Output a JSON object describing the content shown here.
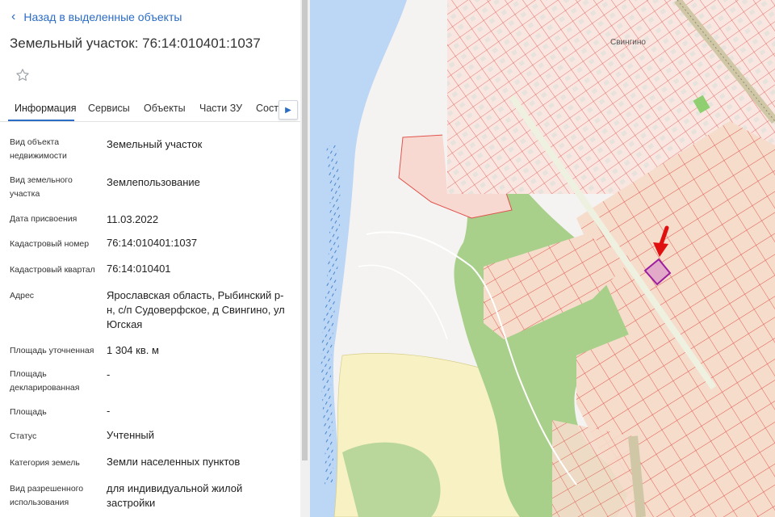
{
  "panel": {
    "back_label": "Назад в выделенные объекты",
    "title": "Земельный участок: 76:14:010401:1037",
    "tabs": [
      {
        "label": "Информация",
        "active": true
      },
      {
        "label": "Сервисы",
        "active": false
      },
      {
        "label": "Объекты",
        "active": false
      },
      {
        "label": "Части ЗУ",
        "active": false
      },
      {
        "label": "Соста",
        "active": false
      }
    ],
    "properties": [
      {
        "label": "Вид объекта недвижимости",
        "value": "Земельный участок"
      },
      {
        "label": "Вид земельного участка",
        "value": "Землепользование"
      },
      {
        "label": "Дата присвоения",
        "value": "11.03.2022"
      },
      {
        "label": "Кадастровый номер",
        "value": "76:14:010401:1037"
      },
      {
        "label": "Кадастровый квартал",
        "value": "76:14:010401"
      },
      {
        "label": "Адрес",
        "value": "Ярославская область, Рыбинский р-н, с/п Судоверфское, д Свингино, ул Югская"
      },
      {
        "label": "Площадь уточненная",
        "value": "1 304 кв. м"
      },
      {
        "label": "Площадь декларированная",
        "value": "-"
      },
      {
        "label": "Площадь",
        "value": "-"
      },
      {
        "label": "Статус",
        "value": "Учтенный"
      },
      {
        "label": "Категория земель",
        "value": "Земли населенных пунктов"
      },
      {
        "label": "Вид разрешенного использования",
        "value": "для индивидуальной жилой застройки"
      }
    ]
  },
  "map": {
    "village_label": "Свингино",
    "colors": {
      "water": "#bcd6f5",
      "forest": "#a8d08a",
      "field": "#f7f1c4",
      "parcel_fill": "#f6dccb",
      "parcel_stroke": "#e0534d",
      "highlight_fill": "#e3a9c9",
      "highlight_stroke": "#9c1da0",
      "arrow": "#e01010",
      "road": "#cfc7a6"
    }
  }
}
